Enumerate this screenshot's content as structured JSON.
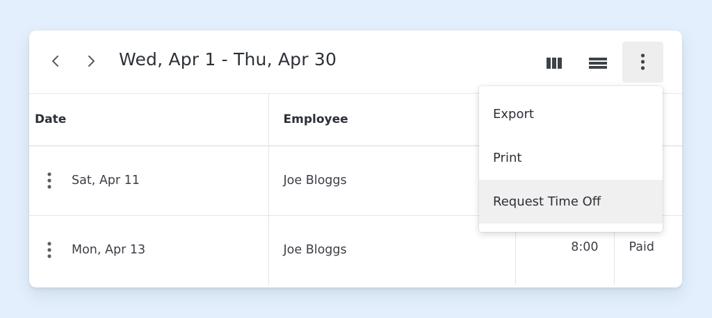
{
  "toolbar": {
    "prev_icon": "chevron-left-icon",
    "next_icon": "chevron-right-icon",
    "date_range": "Wed, Apr 1 - Thu, Apr 30",
    "view_columns_icon": "columns-view-icon",
    "view_rows_icon": "rows-view-icon",
    "more_icon": "vertical-dots-icon"
  },
  "table": {
    "headers": {
      "date": "Date",
      "employee": "Employee",
      "hours": "",
      "type": ""
    },
    "rows": [
      {
        "date": "Sat, Apr 11",
        "employee": "Joe Bloggs",
        "hours": "",
        "type": ""
      },
      {
        "date": "Mon, Apr 13",
        "employee": "Joe Bloggs",
        "hours": "8:00",
        "type": "Paid"
      }
    ]
  },
  "menu": {
    "items": [
      "Export",
      "Print",
      "Request Time Off"
    ],
    "highlighted": "Request Time Off"
  },
  "colors": {
    "background": "#e3effc",
    "card": "#ffffff",
    "menu_highlight": "#f0f0f0"
  }
}
